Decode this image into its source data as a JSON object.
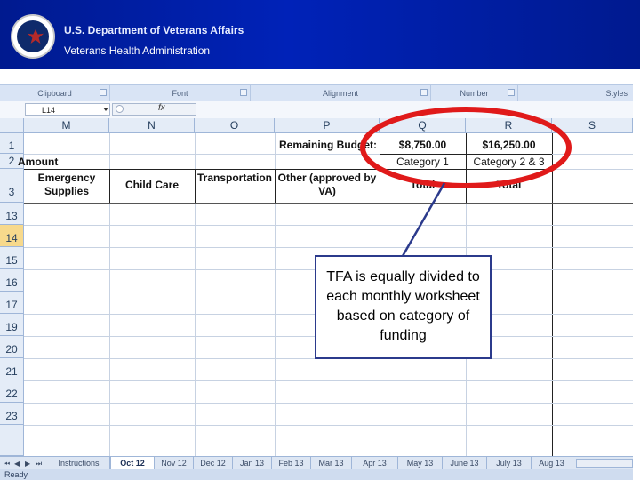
{
  "header": {
    "department": "U.S. Department of Veterans Affairs",
    "administration": "Veterans Health Administration"
  },
  "ribbon": {
    "groups": [
      "Clipboard",
      "Font",
      "Alignment",
      "Number",
      "Styles"
    ]
  },
  "formula_bar": {
    "name_box": "L14",
    "fx": "fx"
  },
  "columns": [
    "M",
    "N",
    "O",
    "P",
    "Q",
    "R",
    "S"
  ],
  "rows": [
    "1",
    "2",
    "3",
    "13",
    "14",
    "15",
    "16",
    "17",
    "19",
    "20",
    "21",
    "22",
    "23"
  ],
  "sheet": {
    "remaining_budget_label": "Remaining Budget:",
    "budget_q": "$8,750.00",
    "budget_r": "$16,250.00",
    "amount_label": "Amount",
    "category_q": "Category 1",
    "category_r": "Category 2 & 3",
    "col_m": "Emergency Supplies",
    "col_n": "Child Care",
    "col_o": "Transportation",
    "col_p": "Other (approved by VA)",
    "total_q": "Total",
    "total_r": "Total"
  },
  "callout": {
    "text": "TFA is equally divided to each monthly worksheet based on category of funding"
  },
  "tabs": [
    "Instructions",
    "Oct 12",
    "Nov 12",
    "Dec 12",
    "Jan 13",
    "Feb 13",
    "Mar 13",
    "Apr 13",
    "May 13",
    "June 13",
    "July 13",
    "Aug 13"
  ],
  "active_tab": "Oct 12",
  "status": "Ready",
  "colors": {
    "banner": "#0022b8",
    "highlight_ring": "#e01a1a",
    "callout_border": "#2b3a8c"
  }
}
